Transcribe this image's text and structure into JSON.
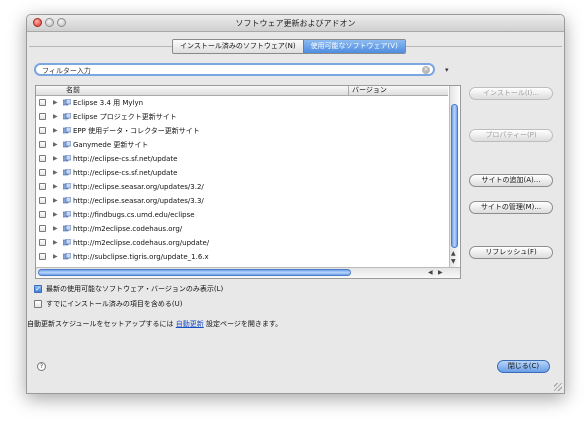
{
  "window": {
    "title": "ソフトウェア更新およびアドオン"
  },
  "tabs": [
    {
      "label": "インストール済みのソフトウェア(N)",
      "active": false
    },
    {
      "label": "使用可能なソフトウェア(V)",
      "active": true
    }
  ],
  "filter": {
    "value": "フィルター入力"
  },
  "table": {
    "columns": [
      "名前",
      "バージョン"
    ],
    "rows": [
      "Eclipse 3.4 用 Mylyn",
      "Eclipse プロジェクト更新サイト",
      "EPP 使用データ・コレクター更新サイト",
      "Ganymede 更新サイト",
      "http://eclipse-cs.sf.net/update",
      "http://eclipse-cs.sf.net/update",
      "http://eclipse.seasar.org/updates/3.2/",
      "http://eclipse.seasar.org/updates/3.3/",
      "http://findbugs.cs.umd.edu/eclipse",
      "http://m2eclipse.codehaus.org/",
      "http://m2eclipse.codehaus.org/update/",
      "http://subclipse.tigris.org/update_1.6.x"
    ]
  },
  "buttons": {
    "install": "インストール(I)...",
    "properties": "プロパティー(P)",
    "add_site": "サイトの追加(A)...",
    "manage_sites": "サイトの管理(M)...",
    "refresh": "リフレッシュ(F)",
    "close": "閉じる(C)"
  },
  "options": {
    "latest_only": "最新の使用可能なソフトウェア・バージョンのみ表示(L)",
    "include_installed": "すでにインストール済みの項目を含める(U)"
  },
  "schedule": {
    "prefix": "自動更新スケジュールをセットアップするには",
    "link": "自動更新",
    "suffix": "設定ページを開きます。"
  },
  "colors": {
    "accent": "#4f8de0",
    "link": "#1a4fc2"
  }
}
